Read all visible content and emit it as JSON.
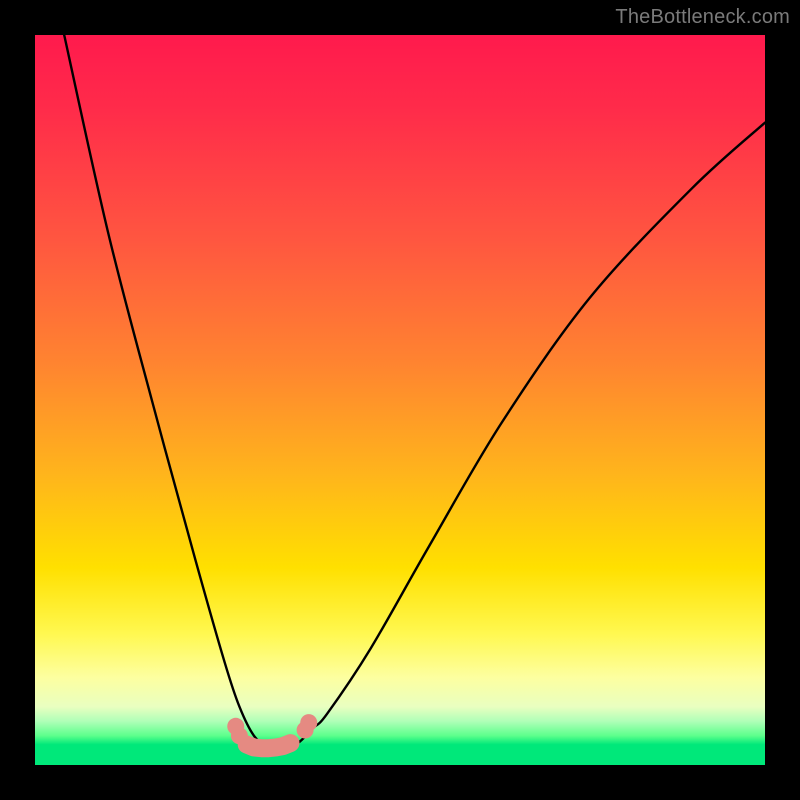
{
  "watermark": "TheBottleneck.com",
  "chart_data": {
    "type": "line",
    "title": "",
    "xlabel": "",
    "ylabel": "",
    "xlim": [
      0,
      100
    ],
    "ylim": [
      0,
      100
    ],
    "series": [
      {
        "name": "bottleneck-curve",
        "x": [
          4,
          10,
          16,
          22,
          26,
          28,
          30,
          32,
          34,
          36,
          38,
          40,
          46,
          54,
          64,
          76,
          90,
          100
        ],
        "y": [
          100,
          73,
          50,
          28,
          14,
          8,
          4,
          2.5,
          2.5,
          3,
          5,
          7,
          16,
          30,
          47,
          64,
          79,
          88
        ]
      }
    ],
    "markers": [
      {
        "name": "left-dots",
        "x": [
          27.5,
          28.0
        ],
        "y": [
          5.3,
          4.0
        ]
      },
      {
        "name": "valley-blob",
        "x": [
          29,
          30,
          31,
          32,
          33,
          34,
          35
        ],
        "y": [
          2.8,
          2.4,
          2.3,
          2.3,
          2.4,
          2.6,
          3.0
        ]
      },
      {
        "name": "right-dots",
        "x": [
          37.0,
          37.5
        ],
        "y": [
          4.8,
          5.8
        ]
      }
    ],
    "marker_color": "#e58a82",
    "curve_color": "#000000",
    "gradient_stops": [
      {
        "pos": 0,
        "color": "#ff1a4d"
      },
      {
        "pos": 0.45,
        "color": "#ff8430"
      },
      {
        "pos": 0.75,
        "color": "#ffe000"
      },
      {
        "pos": 0.92,
        "color": "#e9ffc0"
      },
      {
        "pos": 0.97,
        "color": "#00e87a"
      },
      {
        "pos": 1.0,
        "color": "#00e87a"
      }
    ]
  }
}
